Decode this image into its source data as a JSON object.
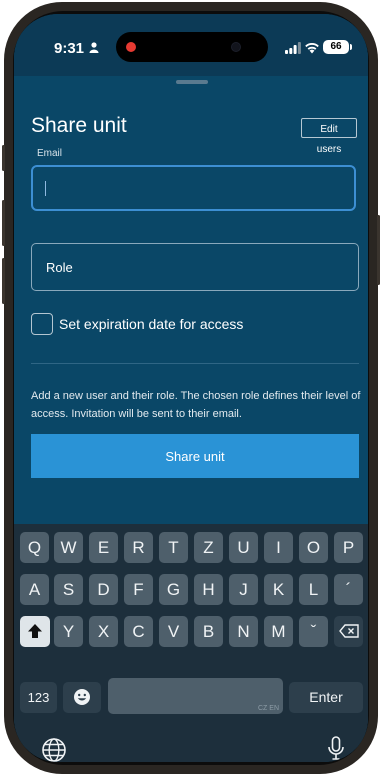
{
  "status_bar": {
    "time": "9:31",
    "battery": "66"
  },
  "sheet": {
    "title": "Share unit",
    "edit_users_label": "Edit users",
    "email_label": "Email",
    "role_placeholder": "Role",
    "expiration_label": "Set expiration date for access",
    "help_text": "Add a new user and their role. The chosen role defines their level of access. Invitation will be sent to their email.",
    "share_button_label": "Share unit"
  },
  "keyboard": {
    "row1": [
      "Q",
      "W",
      "E",
      "R",
      "T",
      "Z",
      "U",
      "I",
      "O",
      "P"
    ],
    "row2": [
      "A",
      "S",
      "D",
      "F",
      "G",
      "H",
      "J",
      "K",
      "L",
      "´"
    ],
    "row3": [
      "Y",
      "X",
      "C",
      "V",
      "B",
      "N",
      "M",
      "ˇ"
    ],
    "numbers_label": "123",
    "space_language_hint": "CZ EN",
    "enter_label": "Enter"
  }
}
